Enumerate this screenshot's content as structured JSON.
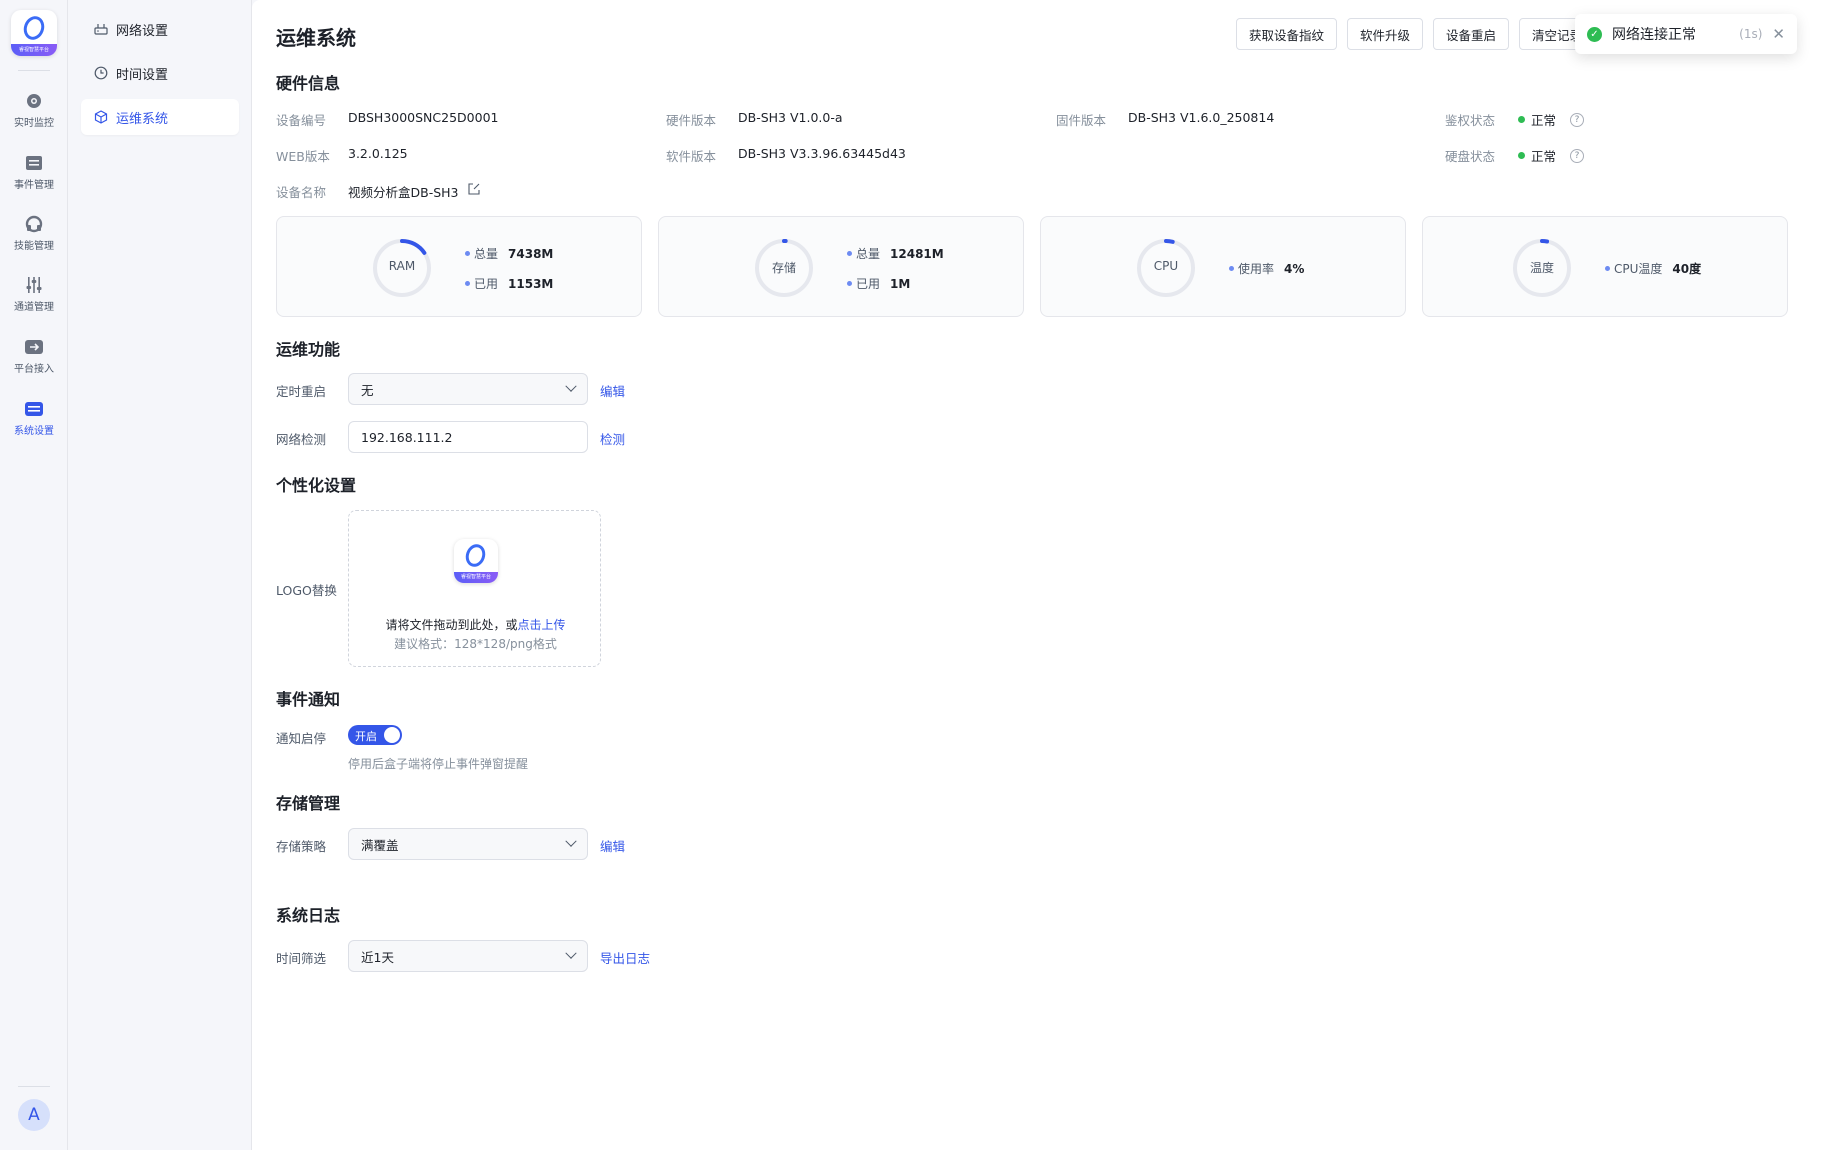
{
  "rail": {
    "logo_strip": "睿视智慧平台",
    "items": [
      {
        "label": "实时监控",
        "icon": "monitor-icon"
      },
      {
        "label": "事件管理",
        "icon": "event-icon"
      },
      {
        "label": "技能管理",
        "icon": "skill-icon"
      },
      {
        "label": "通道管理",
        "icon": "channel-icon"
      },
      {
        "label": "平台接入",
        "icon": "platform-icon"
      },
      {
        "label": "系统设置",
        "icon": "settings-icon"
      }
    ],
    "avatar": "A"
  },
  "subnav": {
    "items": [
      {
        "label": "网络设置"
      },
      {
        "label": "时间设置"
      },
      {
        "label": "运维系统"
      }
    ]
  },
  "page": {
    "title": "运维系统"
  },
  "actions": {
    "fingerprint": "获取设备指纹",
    "upgrade": "软件升级",
    "reboot": "设备重启",
    "clear": "清空记录"
  },
  "toast": {
    "message": "网络连接正常",
    "countdown": "(1s)"
  },
  "hardware": {
    "title": "硬件信息",
    "device_no_label": "设备编号",
    "device_no": "DBSH3000SNC25D0001",
    "hw_ver_label": "硬件版本",
    "hw_ver": "DB-SH3 V1.0.0-a",
    "fw_ver_label": "固件版本",
    "fw_ver": "DB-SH3 V1.6.0_250814",
    "auth_label": "鉴权状态",
    "auth_status": "正常",
    "web_ver_label": "WEB版本",
    "web_ver": "3.2.0.125",
    "sw_ver_label": "软件版本",
    "sw_ver": "DB-SH3 V3.3.96.63445d43",
    "disk_label": "硬盘状态",
    "disk_status": "正常",
    "name_label": "设备名称",
    "name": "视频分析盒DB-SH3"
  },
  "cards": {
    "ram": {
      "label": "RAM",
      "total_label": "总量",
      "total": "7438M",
      "used_label": "已用",
      "used": "1153M",
      "ratio": 0.155
    },
    "storage": {
      "label": "存储",
      "total_label": "总量",
      "total": "12481M",
      "used_label": "已用",
      "used": "1M",
      "ratio": 0.01
    },
    "cpu": {
      "label": "CPU",
      "usage_label": "使用率",
      "usage": "4%",
      "ratio": 0.04
    },
    "temp": {
      "label": "温度",
      "temp_label": "CPU温度",
      "temp": "40度",
      "ratio": 0.03
    }
  },
  "ops": {
    "title": "运维功能",
    "reboot_label": "定时重启",
    "reboot_value": "无",
    "reboot_edit": "编辑",
    "net_label": "网络检测",
    "net_value": "192.168.111.2",
    "net_check": "检测"
  },
  "personal": {
    "title": "个性化设置",
    "logo_label": "LOGO替换",
    "upload_text": "请将文件拖动到此处，或",
    "upload_link": "点击上传",
    "upload_hint": "建议格式：128*128/png格式"
  },
  "notify": {
    "title": "事件通知",
    "label": "通知启停",
    "toggle": "开启",
    "hint": "停用后盒子端将停止事件弹窗提醒"
  },
  "storage_mgmt": {
    "title": "存储管理",
    "label": "存储策略",
    "value": "满覆盖",
    "edit": "编辑"
  },
  "logs": {
    "title": "系统日志",
    "label": "时间筛选",
    "value": "近1天",
    "export": "导出日志"
  },
  "colors": {
    "accent": "#3456e8",
    "ok": "#2ebc53",
    "gauge_track": "#e6e8ee"
  }
}
